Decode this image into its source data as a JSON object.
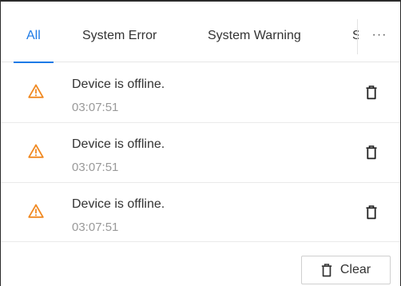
{
  "tabs": [
    {
      "label": "All",
      "active": true
    },
    {
      "label": "System Error",
      "active": false
    },
    {
      "label": "System Warning",
      "active": false
    }
  ],
  "tab_overflow_label": "S",
  "more_label": "···",
  "alarms": [
    {
      "message": "Device is offline.",
      "time": "03:07:51",
      "icon": "warning-triangle-icon"
    },
    {
      "message": "Device is offline.",
      "time": "03:07:51",
      "icon": "warning-triangle-icon"
    },
    {
      "message": "Device is offline.",
      "time": "03:07:51",
      "icon": "warning-triangle-icon"
    }
  ],
  "delete_icon": "trash-icon",
  "clear_label": "Clear",
  "colors": {
    "accent": "#1c7ae6",
    "warning": "#f08a24",
    "muted_text": "#999999"
  }
}
